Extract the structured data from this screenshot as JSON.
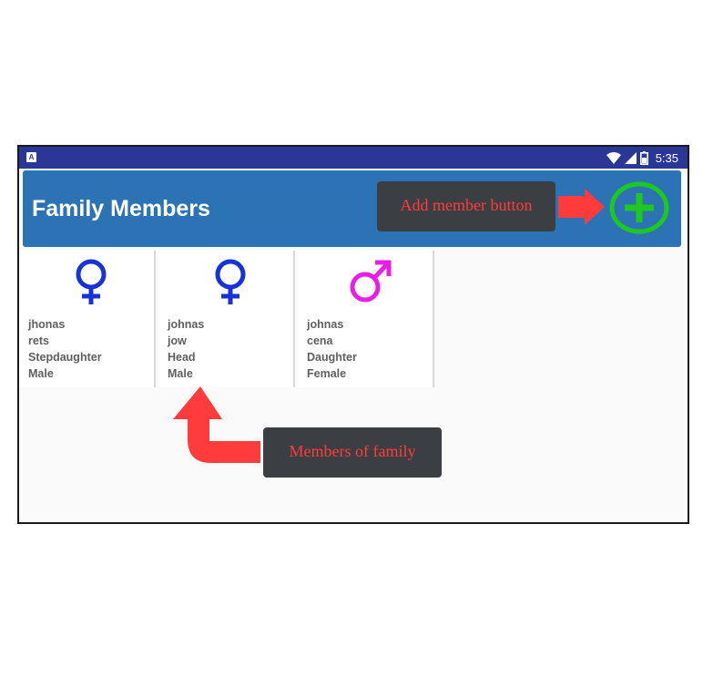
{
  "status_bar": {
    "app_icon_letter": "A",
    "time": "5:35",
    "icons": [
      "wifi-icon",
      "cell-signal-icon",
      "battery-icon"
    ]
  },
  "app_bar": {
    "title": "Family Members",
    "add_button_icon": "plus-circle-icon"
  },
  "members": [
    {
      "gender_icon": "female-symbol-icon",
      "icon_color": "#1733d6",
      "line1": "jhonas",
      "line2": "rets",
      "line3": "Stepdaughter",
      "line4": "Male"
    },
    {
      "gender_icon": "female-symbol-icon",
      "icon_color": "#1733d6",
      "line1": "johnas",
      "line2": "jow",
      "line3": "Head",
      "line4": "Male"
    },
    {
      "gender_icon": "male-symbol-icon",
      "icon_color": "#e81ee6",
      "line1": "johnas",
      "line2": "cena",
      "line3": "Daughter",
      "line4": "Female"
    }
  ],
  "annotations": {
    "add_member": "Add member button",
    "members_of_family": "Members of family"
  },
  "colors": {
    "status_bar": "#2b3797",
    "app_bar": "#2b73b5",
    "add_button": "#1fc81f",
    "arrow": "#ff3b3b",
    "callout_bg": "#3b3f44"
  }
}
